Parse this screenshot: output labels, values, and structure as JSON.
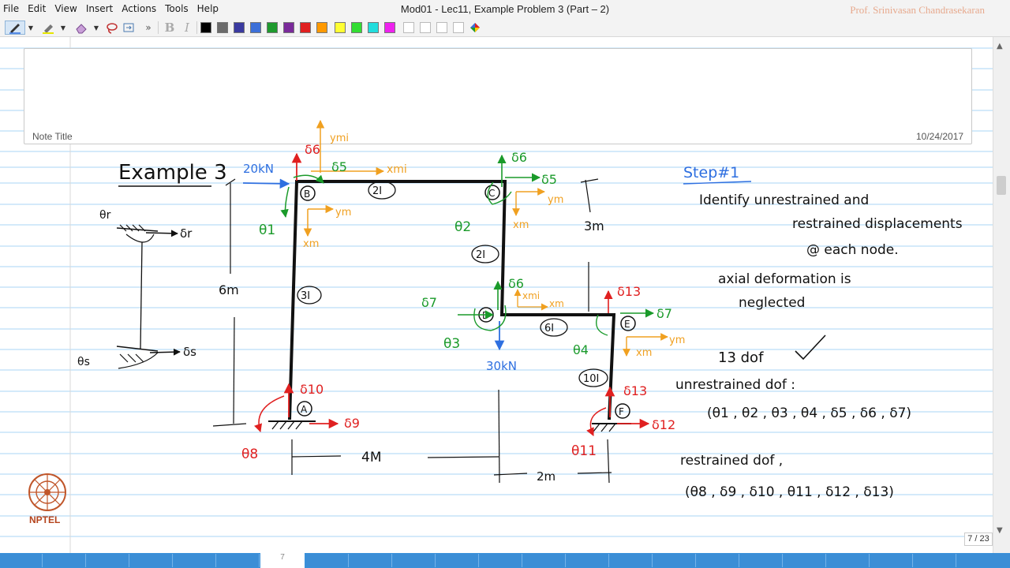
{
  "window": {
    "title": "Mod01 - Lec11,  Example Problem 3 (Part – 2)",
    "author": "Prof. Srinivasan Chandrasekaran"
  },
  "menu": [
    "File",
    "Edit",
    "View",
    "Insert",
    "Actions",
    "Tools",
    "Help"
  ],
  "toolbar": {
    "bold": "B",
    "italic": "I",
    "colors": [
      "#000000",
      "#6b6b6b",
      "#3a3aa0",
      "#3c6fd8",
      "#1f9a2e",
      "#7a2a9a",
      "#e02020",
      "#ff9900",
      "#ffff33",
      "#33dd33",
      "#22dddd",
      "#ee22ee"
    ]
  },
  "note": {
    "title_label": "Note Title",
    "date": "10/24/2017"
  },
  "page_indicator": "7 / 23",
  "slide_number": "7",
  "logo_text": "NPTEL",
  "colors": {
    "ink_black": "#111111",
    "ink_blue": "#2e6fe0",
    "ink_green": "#1a9a2a",
    "ink_red": "#e02020",
    "ink_orange": "#f0a020",
    "ruled_line": "#a9d4f5",
    "bottom_bar": "#3a91da"
  },
  "notes": {
    "heading": "Example 3",
    "load_b": "20kN",
    "load_d": "30kN",
    "height_left": "6m",
    "height_right": "3m",
    "span_ab": "4M",
    "span_de": "2m",
    "stiffness_bc": "2I",
    "stiffness_cd": "2I",
    "stiffness_ab": "3I",
    "stiffness_de": "6I",
    "stiffness_ef": "10I",
    "node_a": "A",
    "node_b": "B",
    "node_c": "C",
    "node_d": "D",
    "node_e": "E",
    "node_f": "F",
    "theta1": "θ1",
    "theta2": "θ2",
    "theta3": "θ3",
    "theta4": "θ4",
    "theta8": "θ8",
    "theta11": "θ11",
    "d5_b": "δ5",
    "d6_b": "δ6",
    "d5_c": "δ5",
    "d6_c": "δ6",
    "d6_d": "δ6",
    "d7_d": "δ7",
    "d7_e": "δ7",
    "d13_e": "δ13",
    "d9": "δ9",
    "d10": "δ10",
    "d12": "δ12",
    "d13_f": "δ13",
    "xm": "xm",
    "ym": "ym",
    "xmi": "xmi",
    "ymi": "ymi",
    "side_theta_r": "θr",
    "side_delta_r": "δr",
    "side_theta_s": "θs",
    "side_delta_s": "δs",
    "step_title": "Step#1",
    "step_line1": "Identify  unrestrained and",
    "step_line2": "restrained displacements",
    "step_line3": "@ each node.",
    "axial_line1": "axial deformation is",
    "axial_line2": "neglected",
    "dof_count": "13  dof",
    "unrestrained_label": "unrestrained  dof :",
    "unrestrained_set": "(θ1 , θ2 , θ3 , θ4 , δ5 , δ6 , δ7)",
    "restrained_label": "restrained  dof ,",
    "restrained_set": "(θ8 , δ9 , δ10 ,  θ11 , δ12 , δ13)"
  }
}
